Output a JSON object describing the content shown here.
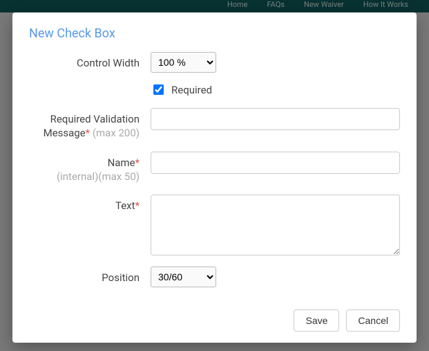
{
  "nav": {
    "items": [
      "Home",
      "FAQs",
      "New Waiver",
      "How It Works"
    ]
  },
  "modal": {
    "title": "New Check Box",
    "fields": {
      "control_width": {
        "label": "Control Width",
        "value": "100 %",
        "options": [
          "100 %"
        ]
      },
      "required_checkbox": {
        "label": "Required",
        "checked": true
      },
      "required_validation": {
        "label": "Required Validation Message",
        "hint": "(max 200)",
        "value": ""
      },
      "name": {
        "label": "Name",
        "hint": "(internal)(max 50)",
        "value": ""
      },
      "text": {
        "label": "Text",
        "value": ""
      },
      "position": {
        "label": "Position",
        "value": "30/60",
        "options": [
          "30/60"
        ]
      }
    },
    "buttons": {
      "save": "Save",
      "cancel": "Cancel"
    }
  }
}
